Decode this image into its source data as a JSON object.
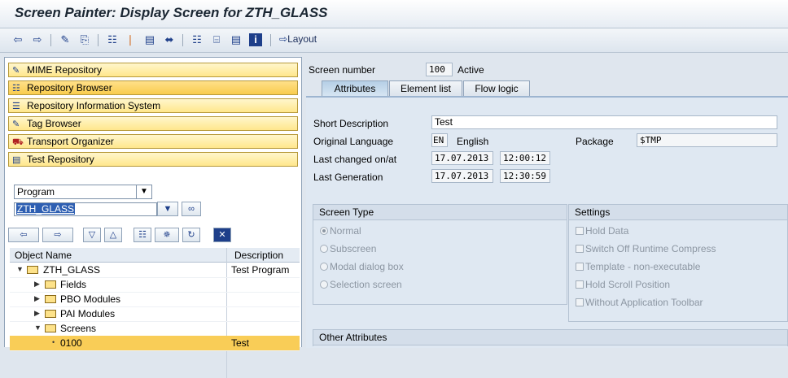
{
  "window": {
    "title": "Screen Painter: Display Screen for ZTH_GLASS"
  },
  "toolbar": {
    "layout_label": "Layout"
  },
  "nav_buttons": [
    {
      "label": "MIME Repository"
    },
    {
      "label": "Repository Browser"
    },
    {
      "label": "Repository Information System"
    },
    {
      "label": "Tag Browser"
    },
    {
      "label": "Transport Organizer"
    },
    {
      "label": "Test Repository"
    }
  ],
  "object_selector": {
    "type_value": "Program",
    "name_value": "ZTH_GLASS"
  },
  "tree": {
    "col_object_name": "Object Name",
    "col_description": "Description",
    "rows": [
      {
        "name": "ZTH_GLASS",
        "desc": "Test Program"
      },
      {
        "name": "Fields",
        "desc": ""
      },
      {
        "name": "PBO Modules",
        "desc": ""
      },
      {
        "name": "PAI Modules",
        "desc": ""
      },
      {
        "name": "Screens",
        "desc": ""
      },
      {
        "name": "0100",
        "desc": "Test"
      }
    ]
  },
  "screen": {
    "number_label": "Screen number",
    "number_value": "100",
    "status": "Active"
  },
  "tabs": [
    {
      "label": "Attributes"
    },
    {
      "label": "Element list"
    },
    {
      "label": "Flow logic"
    }
  ],
  "attributes": {
    "short_desc_label": "Short Description",
    "short_desc_value": "Test",
    "orig_lang_label": "Original Language",
    "orig_lang_code": "EN",
    "orig_lang_name": "English",
    "package_label": "Package",
    "package_value": "$TMP",
    "last_changed_label": "Last changed on/at",
    "last_changed_date": "17.07.2013",
    "last_changed_time": "12:00:12",
    "last_gen_label": "Last Generation",
    "last_gen_date": "17.07.2013",
    "last_gen_time": "12:30:59"
  },
  "screen_type": {
    "title": "Screen Type",
    "options": [
      "Normal",
      "Subscreen",
      "Modal dialog box",
      "Selection screen"
    ]
  },
  "settings": {
    "title": "Settings",
    "options": [
      "Hold Data",
      "Switch Off Runtime Compress",
      "Template - non-executable",
      "Hold Scroll Position",
      "Without Application Toolbar"
    ]
  },
  "other_attributes": {
    "title": "Other Attributes"
  }
}
